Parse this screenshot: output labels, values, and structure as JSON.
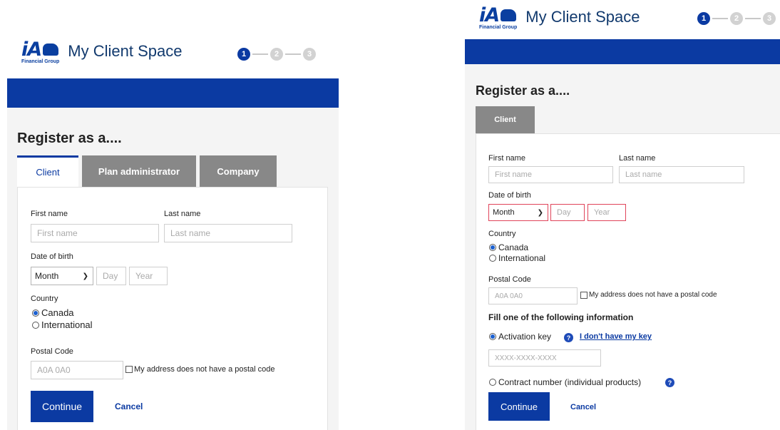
{
  "logo": {
    "mark": "iA",
    "subtext": "Financial Group"
  },
  "app_title": "My Client Space",
  "steps": [
    "1",
    "2",
    "3"
  ],
  "page_title": "Register as a....",
  "left": {
    "tabs": [
      {
        "label": "Client"
      },
      {
        "label": "Plan administrator"
      },
      {
        "label": "Company"
      }
    ],
    "first_name_label": "First name",
    "first_name_placeholder": "First name",
    "last_name_label": "Last name",
    "last_name_placeholder": "Last name",
    "dob_label": "Date of birth",
    "month_value": "Month",
    "day_placeholder": "Day",
    "year_placeholder": "Year",
    "country_label": "Country",
    "country_options": [
      "Canada",
      "International"
    ],
    "postal_label": "Postal Code",
    "postal_placeholder": "A0A 0A0",
    "no_postal_label": "My address does not have a postal code",
    "continue_label": "Continue",
    "cancel_label": "Cancel"
  },
  "right": {
    "tabs": [
      {
        "label": "Client"
      }
    ],
    "first_name_label": "First name",
    "first_name_placeholder": "First name",
    "last_name_label": "Last name",
    "last_name_placeholder": "Last name",
    "dob_label": "Date of birth",
    "month_value": "Month",
    "day_placeholder": "Day",
    "year_placeholder": "Year",
    "country_label": "Country",
    "country_options": [
      "Canada",
      "International"
    ],
    "postal_label": "Postal Code",
    "postal_placeholder": "A0A 0A0",
    "no_postal_label": "My address does not have a postal code",
    "fill_heading": "Fill one of the following information",
    "activation_key_label": "Activation key",
    "no_key_link": "I don't have my key",
    "key_placeholder": "XXXX-XXXX-XXXX",
    "contract_label": "Contract number (individual products)",
    "continue_label": "Continue",
    "cancel_label": "Cancel"
  },
  "colors": {
    "brand_blue": "#0b3aa2",
    "tab_gray": "#888888",
    "error_red": "#e0445a"
  }
}
